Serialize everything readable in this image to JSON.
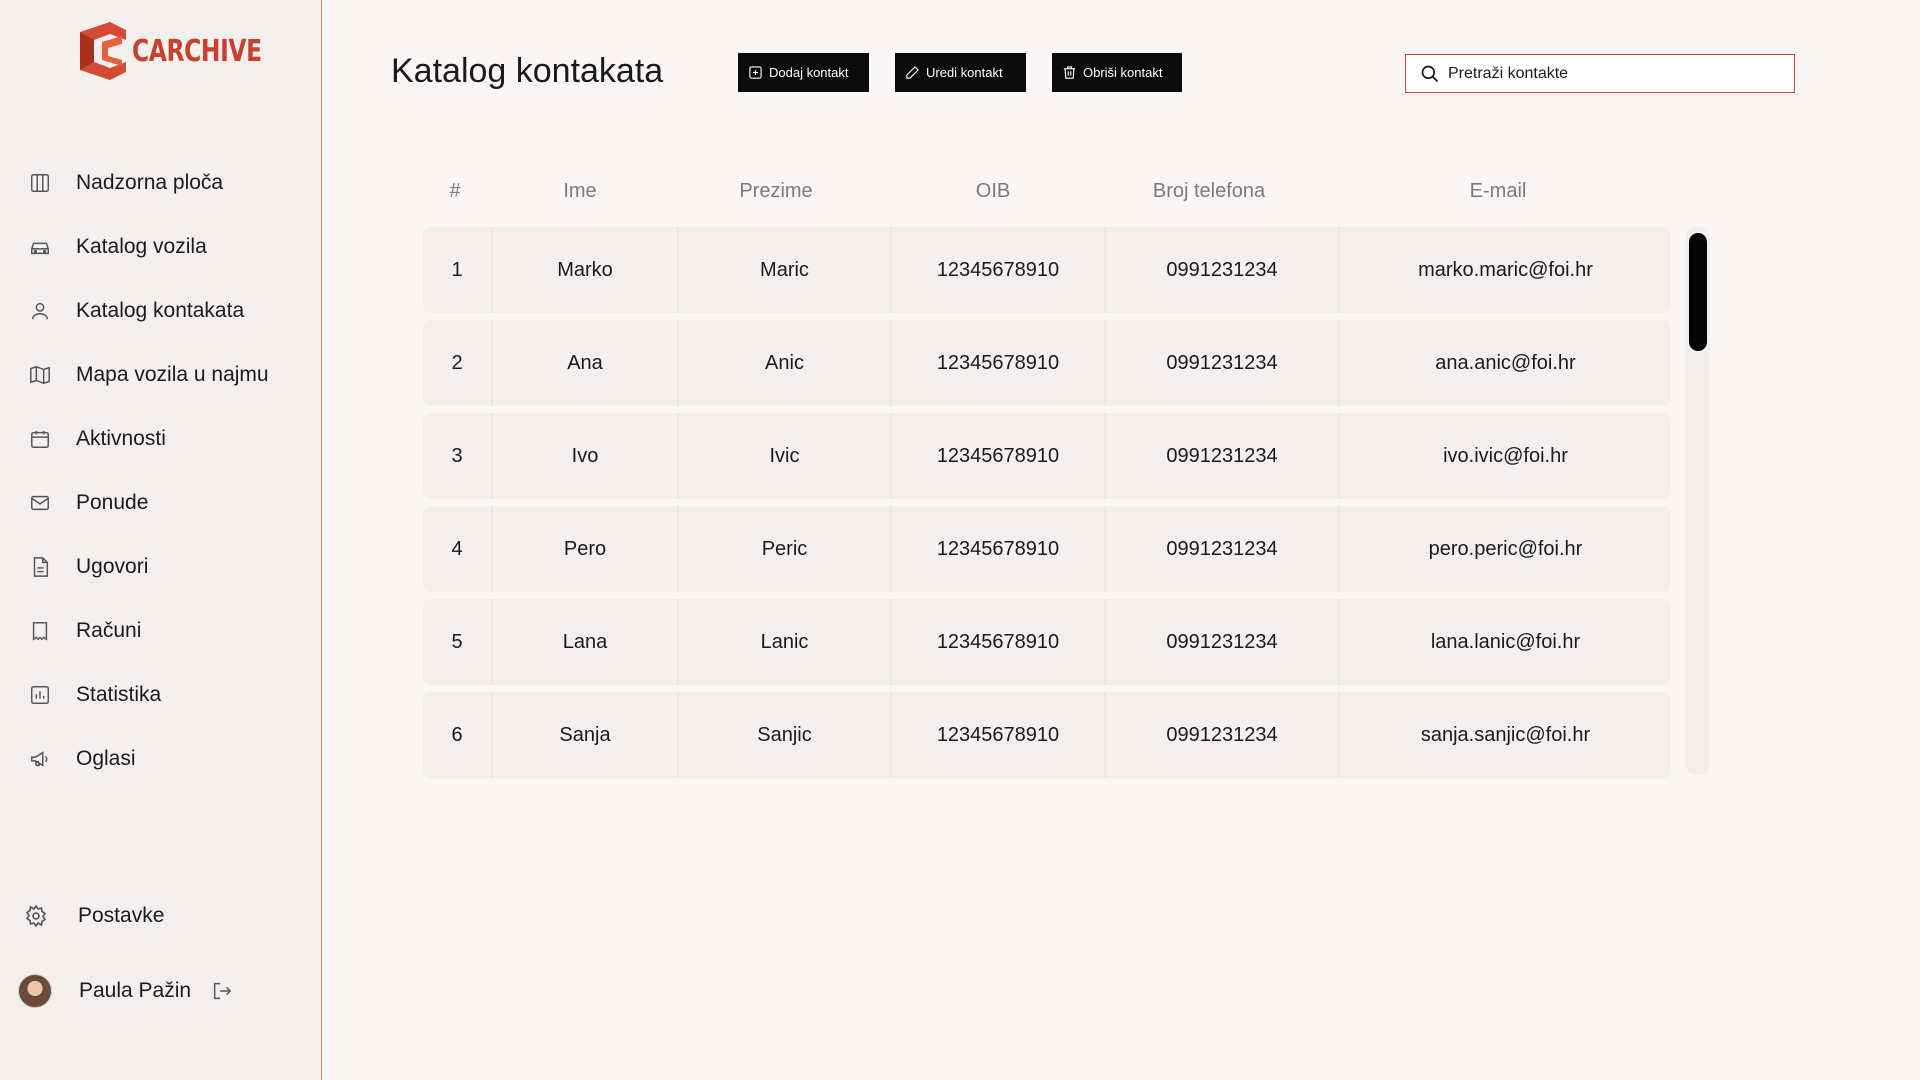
{
  "brand": {
    "logo_text": "CARCHIVE",
    "accent": "#c8402e"
  },
  "sidebar": {
    "items": [
      {
        "label": "Nadzorna ploča",
        "icon": "dashboard-icon"
      },
      {
        "label": "Katalog vozila",
        "icon": "car-icon"
      },
      {
        "label": "Katalog kontakata",
        "icon": "user-icon"
      },
      {
        "label": "Mapa vozila u najmu",
        "icon": "map-icon"
      },
      {
        "label": "Aktivnosti",
        "icon": "calendar-icon"
      },
      {
        "label": "Ponude",
        "icon": "mail-icon"
      },
      {
        "label": "Ugovori",
        "icon": "document-icon"
      },
      {
        "label": "Računi",
        "icon": "receipt-icon"
      },
      {
        "label": "Statistika",
        "icon": "chart-icon"
      },
      {
        "label": "Oglasi",
        "icon": "megaphone-icon"
      }
    ],
    "settings_label": "Postavke",
    "user_name": "Paula Pažin"
  },
  "header": {
    "title": "Katalog kontakata",
    "add_label": "Dodaj kontakt",
    "edit_label": "Uredi kontakt",
    "delete_label": "Obriši kontakt",
    "search_placeholder": "Pretraži kontakte"
  },
  "table": {
    "headers": [
      "#",
      "Ime",
      "Prezime",
      "OIB",
      "Broj telefona",
      "E-mail"
    ],
    "rows": [
      [
        "1",
        "Marko",
        "Maric",
        "12345678910",
        "0991231234",
        "marko.maric@foi.hr"
      ],
      [
        "2",
        "Ana",
        "Anic",
        "12345678910",
        "0991231234",
        "ana.anic@foi.hr"
      ],
      [
        "3",
        "Ivo",
        "Ivic",
        "12345678910",
        "0991231234",
        "ivo.ivic@foi.hr"
      ],
      [
        "4",
        "Pero",
        "Peric",
        "12345678910",
        "0991231234",
        "pero.peric@foi.hr"
      ],
      [
        "5",
        "Lana",
        "Lanic",
        "12345678910",
        "0991231234",
        "lana.lanic@foi.hr"
      ],
      [
        "6",
        "Sanja",
        "Sanjic",
        "12345678910",
        "0991231234",
        "sanja.sanjic@foi.hr"
      ]
    ]
  }
}
